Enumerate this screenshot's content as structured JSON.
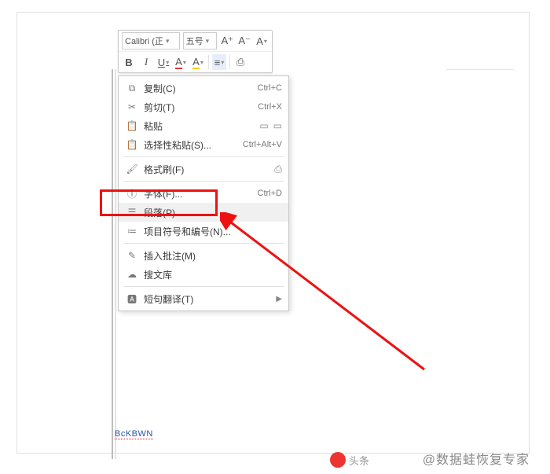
{
  "toolbar": {
    "font_combo": "Calibri (正",
    "size_combo": "五号",
    "inc": "A⁺",
    "dec": "A⁻",
    "case": "A",
    "bold": "B",
    "italic": "I",
    "underline": "U",
    "fontcolor": "A",
    "highlight": "A",
    "align": "≡",
    "print": "⎙"
  },
  "menu": {
    "copy": {
      "label": "复制(C)",
      "shortcut": "Ctrl+C"
    },
    "cut": {
      "label": "剪切(T)",
      "shortcut": "Ctrl+X"
    },
    "paste": {
      "label": "粘贴"
    },
    "paste_special": {
      "label": "选择性粘贴(S)...",
      "shortcut": "Ctrl+Alt+V"
    },
    "format_painter": {
      "label": "格式刷(F)"
    },
    "font": {
      "label": "字体(F)...",
      "shortcut": "Ctrl+D"
    },
    "paragraph": {
      "label": "段落(P)..."
    },
    "bullets": {
      "label": "项目符号和编号(N)..."
    },
    "insert_comment": {
      "label": "插入批注(M)"
    },
    "search_lib": {
      "label": "搜文库"
    },
    "translate": {
      "label": "短句翻译(T)"
    }
  },
  "doc": {
    "footer_text": "BcKBWN"
  },
  "watermark": {
    "logo": "头条",
    "author": "@数据蛙恢复专家"
  }
}
